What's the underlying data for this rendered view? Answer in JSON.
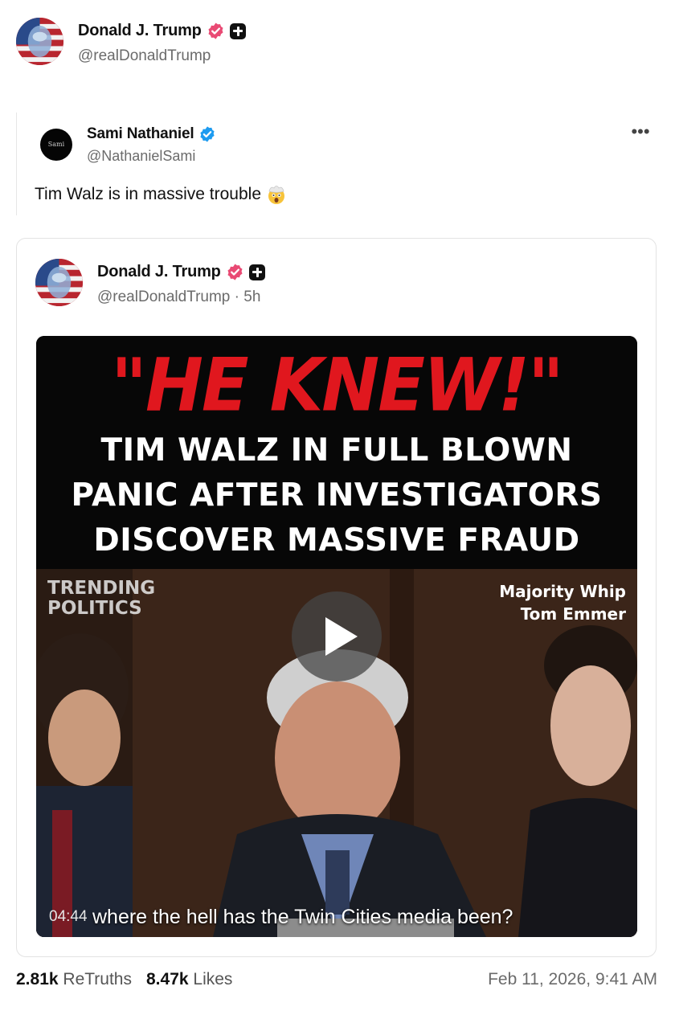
{
  "author": {
    "name": "Donald J. Trump",
    "handle": "@realDonaldTrump"
  },
  "quoted": {
    "name": "Sami Nathaniel",
    "handle": "@NathanielSami",
    "avatar_text": "Sami",
    "text": "Tim Walz is in massive trouble",
    "more_label": "•••"
  },
  "embedded": {
    "name": "Donald J. Trump",
    "handle_time": "@realDonaldTrump · 5h",
    "video": {
      "headline_red": "\"HE KNEW!\"",
      "headline_lines": [
        "TIM WALZ IN FULL BLOWN",
        "PANIC AFTER INVESTIGATORS",
        "DISCOVER MASSIVE FRAUD"
      ],
      "watermark_line1": "TRENDING",
      "watermark_line2": "POLITICS",
      "lower_third_line1": "Majority Whip",
      "lower_third_line2": "Tom Emmer",
      "timestamp": "04:44",
      "caption": "where the hell has the Twin Cities media been?"
    }
  },
  "stats": {
    "retruths_count": "2.81k",
    "retruths_label": "ReTruths",
    "likes_count": "8.47k",
    "likes_label": "Likes",
    "date": "Feb 11, 2026, 9:41 AM"
  },
  "colors": {
    "verified_badge": "#e94a74",
    "blue_check": "#1d9bf0",
    "headline_red": "#e0171e"
  }
}
